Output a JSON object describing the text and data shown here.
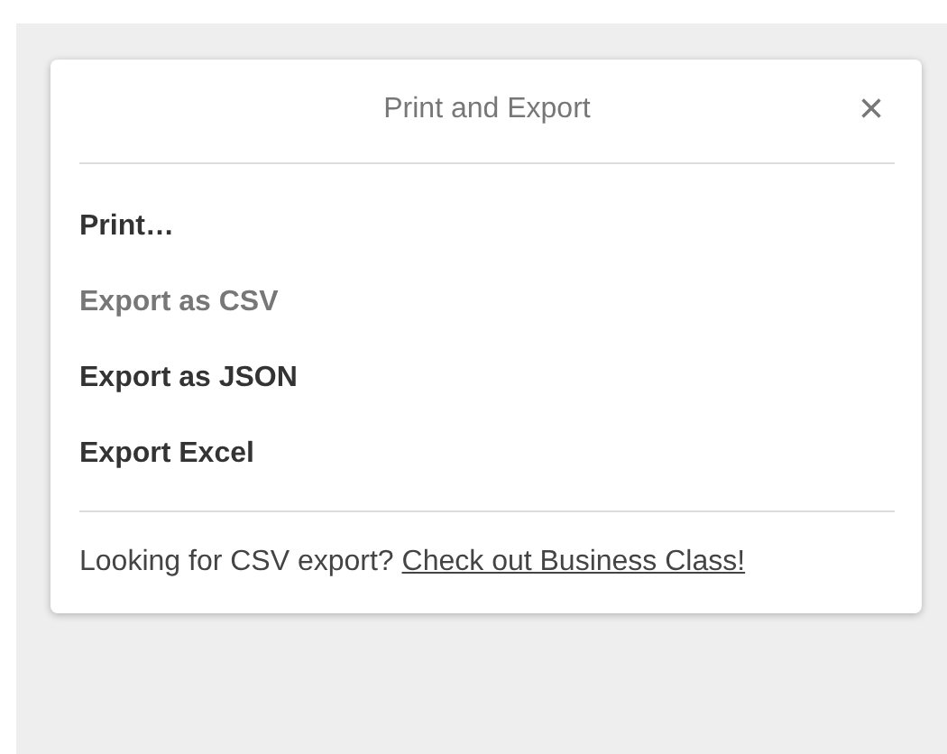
{
  "dialog": {
    "title": "Print and Export",
    "close": "×",
    "items": [
      {
        "label": "Print…",
        "disabled": false
      },
      {
        "label": "Export as CSV",
        "disabled": true
      },
      {
        "label": "Export as JSON",
        "disabled": false
      },
      {
        "label": "Export Excel",
        "disabled": false
      }
    ],
    "footer": {
      "text": "Looking for CSV export?",
      "link": "Check out Business Class!"
    }
  }
}
